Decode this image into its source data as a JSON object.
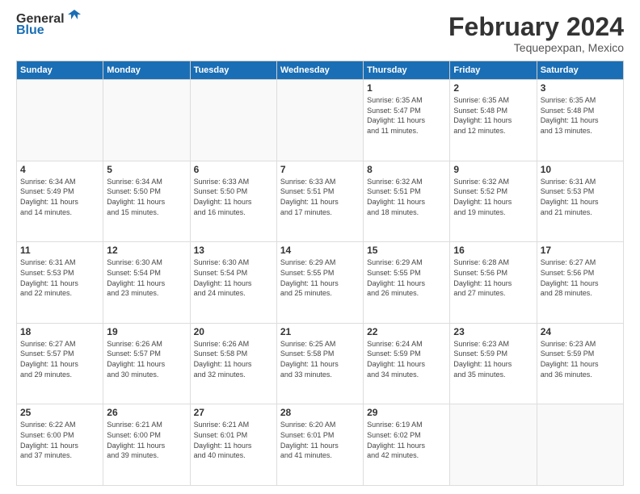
{
  "logo": {
    "text_general": "General",
    "text_blue": "Blue"
  },
  "header": {
    "title": "February 2024",
    "subtitle": "Tequepexpan, Mexico"
  },
  "weekdays": [
    "Sunday",
    "Monday",
    "Tuesday",
    "Wednesday",
    "Thursday",
    "Friday",
    "Saturday"
  ],
  "weeks": [
    [
      {
        "day": "",
        "info": ""
      },
      {
        "day": "",
        "info": ""
      },
      {
        "day": "",
        "info": ""
      },
      {
        "day": "",
        "info": ""
      },
      {
        "day": "1",
        "info": "Sunrise: 6:35 AM\nSunset: 5:47 PM\nDaylight: 11 hours\nand 11 minutes."
      },
      {
        "day": "2",
        "info": "Sunrise: 6:35 AM\nSunset: 5:48 PM\nDaylight: 11 hours\nand 12 minutes."
      },
      {
        "day": "3",
        "info": "Sunrise: 6:35 AM\nSunset: 5:48 PM\nDaylight: 11 hours\nand 13 minutes."
      }
    ],
    [
      {
        "day": "4",
        "info": "Sunrise: 6:34 AM\nSunset: 5:49 PM\nDaylight: 11 hours\nand 14 minutes."
      },
      {
        "day": "5",
        "info": "Sunrise: 6:34 AM\nSunset: 5:50 PM\nDaylight: 11 hours\nand 15 minutes."
      },
      {
        "day": "6",
        "info": "Sunrise: 6:33 AM\nSunset: 5:50 PM\nDaylight: 11 hours\nand 16 minutes."
      },
      {
        "day": "7",
        "info": "Sunrise: 6:33 AM\nSunset: 5:51 PM\nDaylight: 11 hours\nand 17 minutes."
      },
      {
        "day": "8",
        "info": "Sunrise: 6:32 AM\nSunset: 5:51 PM\nDaylight: 11 hours\nand 18 minutes."
      },
      {
        "day": "9",
        "info": "Sunrise: 6:32 AM\nSunset: 5:52 PM\nDaylight: 11 hours\nand 19 minutes."
      },
      {
        "day": "10",
        "info": "Sunrise: 6:31 AM\nSunset: 5:53 PM\nDaylight: 11 hours\nand 21 minutes."
      }
    ],
    [
      {
        "day": "11",
        "info": "Sunrise: 6:31 AM\nSunset: 5:53 PM\nDaylight: 11 hours\nand 22 minutes."
      },
      {
        "day": "12",
        "info": "Sunrise: 6:30 AM\nSunset: 5:54 PM\nDaylight: 11 hours\nand 23 minutes."
      },
      {
        "day": "13",
        "info": "Sunrise: 6:30 AM\nSunset: 5:54 PM\nDaylight: 11 hours\nand 24 minutes."
      },
      {
        "day": "14",
        "info": "Sunrise: 6:29 AM\nSunset: 5:55 PM\nDaylight: 11 hours\nand 25 minutes."
      },
      {
        "day": "15",
        "info": "Sunrise: 6:29 AM\nSunset: 5:55 PM\nDaylight: 11 hours\nand 26 minutes."
      },
      {
        "day": "16",
        "info": "Sunrise: 6:28 AM\nSunset: 5:56 PM\nDaylight: 11 hours\nand 27 minutes."
      },
      {
        "day": "17",
        "info": "Sunrise: 6:27 AM\nSunset: 5:56 PM\nDaylight: 11 hours\nand 28 minutes."
      }
    ],
    [
      {
        "day": "18",
        "info": "Sunrise: 6:27 AM\nSunset: 5:57 PM\nDaylight: 11 hours\nand 29 minutes."
      },
      {
        "day": "19",
        "info": "Sunrise: 6:26 AM\nSunset: 5:57 PM\nDaylight: 11 hours\nand 30 minutes."
      },
      {
        "day": "20",
        "info": "Sunrise: 6:26 AM\nSunset: 5:58 PM\nDaylight: 11 hours\nand 32 minutes."
      },
      {
        "day": "21",
        "info": "Sunrise: 6:25 AM\nSunset: 5:58 PM\nDaylight: 11 hours\nand 33 minutes."
      },
      {
        "day": "22",
        "info": "Sunrise: 6:24 AM\nSunset: 5:59 PM\nDaylight: 11 hours\nand 34 minutes."
      },
      {
        "day": "23",
        "info": "Sunrise: 6:23 AM\nSunset: 5:59 PM\nDaylight: 11 hours\nand 35 minutes."
      },
      {
        "day": "24",
        "info": "Sunrise: 6:23 AM\nSunset: 5:59 PM\nDaylight: 11 hours\nand 36 minutes."
      }
    ],
    [
      {
        "day": "25",
        "info": "Sunrise: 6:22 AM\nSunset: 6:00 PM\nDaylight: 11 hours\nand 37 minutes."
      },
      {
        "day": "26",
        "info": "Sunrise: 6:21 AM\nSunset: 6:00 PM\nDaylight: 11 hours\nand 39 minutes."
      },
      {
        "day": "27",
        "info": "Sunrise: 6:21 AM\nSunset: 6:01 PM\nDaylight: 11 hours\nand 40 minutes."
      },
      {
        "day": "28",
        "info": "Sunrise: 6:20 AM\nSunset: 6:01 PM\nDaylight: 11 hours\nand 41 minutes."
      },
      {
        "day": "29",
        "info": "Sunrise: 6:19 AM\nSunset: 6:02 PM\nDaylight: 11 hours\nand 42 minutes."
      },
      {
        "day": "",
        "info": ""
      },
      {
        "day": "",
        "info": ""
      }
    ]
  ]
}
